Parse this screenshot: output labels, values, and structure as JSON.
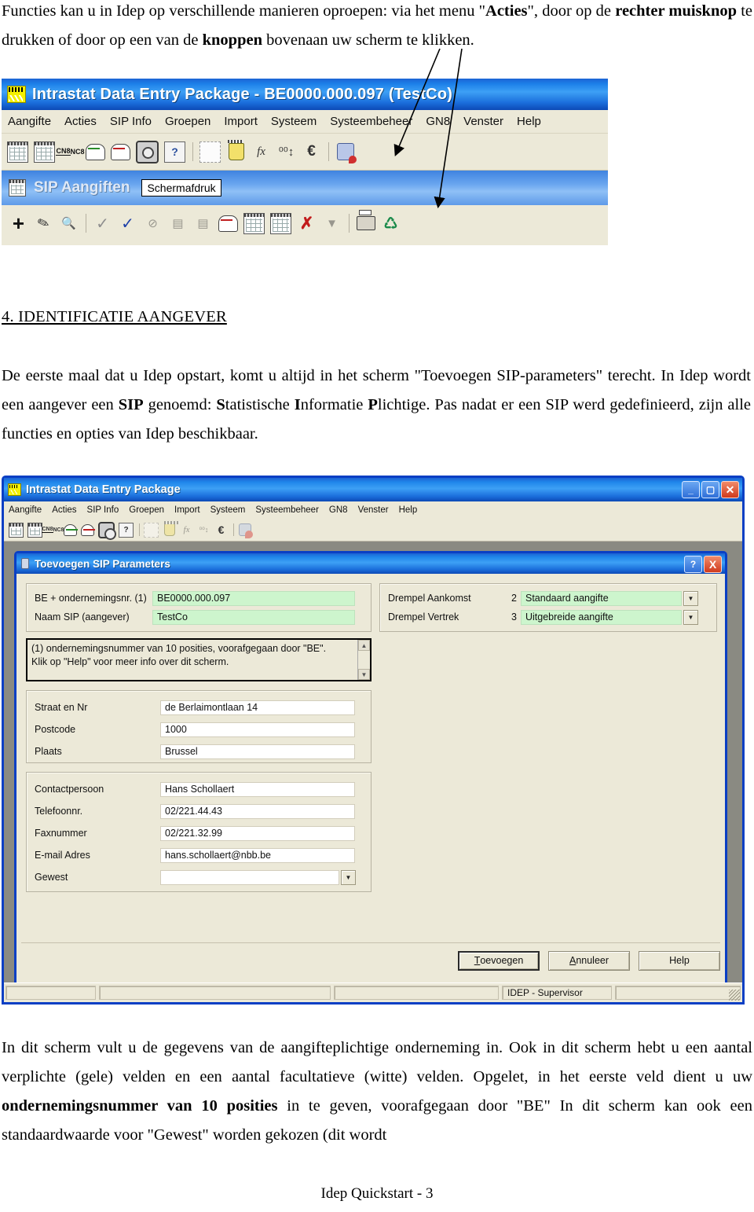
{
  "document": {
    "intro_html": "Functies kan u in Idep op verschillende manieren oproepen: via het  menu \"<b>Acties</b>\", door op de <b>rechter muisknop</b> te drukken of door op een van de <b>knoppen</b> bovenaan uw scherm te klikken.",
    "heading": "4. IDENTIFICATIE AANGEVER",
    "body1_html": "De eerste maal dat u Idep opstart, komt u altijd in het scherm \"Toevoegen SIP-parameters\" terecht. In Idep wordt een aangever een <b>SIP</b> genoemd: <b>S</b>tatistische <b>I</b>nformatie <b>P</b>lichtige. Pas nadat er een SIP werd gedefinieerd, zijn alle functies en opties van Idep beschikbaar.",
    "body2_html": "In dit scherm vult u de gegevens van de aangifteplichtige onderneming in. Ook in dit scherm hebt u een aantal verplichte (gele) velden en een aantal facultatieve (witte) velden. Opgelet, in het eerste veld dient u uw <b>ondernemingsnummer van 10 posities</b> in te geven, voorafgegaan door \"BE\" In dit scherm kan ook een standaardwaarde voor \"Gewest\" worden gekozen (dit wordt",
    "footer": "Idep Quickstart - 3"
  },
  "screenshot1": {
    "title": "Intrastat Data Entry Package - BE0000.000.097 (TestCo)",
    "menu": [
      "Aangifte",
      "Acties",
      "SIP Info",
      "Groepen",
      "Import",
      "Systeem",
      "Systeembeheer",
      "GN8",
      "Venster",
      "Help"
    ],
    "toolbar_icons": [
      "grid-icon",
      "binoculars-grid-icon",
      "cn8-nc8-icon",
      "envelope-green-icon",
      "envelope-red-icon",
      "camera-icon",
      "question-balloon-icon",
      "blank-page-icon",
      "bin-icon",
      "fx-icon",
      "decimal-icon",
      "euro-icon",
      "screenprint-icon"
    ],
    "subwindow_title": "SIP Aangiften",
    "tooltip": "Schermafdruk",
    "subtoolbar_icons": [
      "plus-icon",
      "pencil-icon",
      "magnifier-doc-icon",
      "check-icon",
      "check-plus-icon",
      "cancel-icon",
      "unlock-icon",
      "lock-doc-icon",
      "envelope-red-icon",
      "grid-search-icon",
      "grid-edit-icon",
      "delete-x-icon",
      "download-icon",
      "printer-icon",
      "recycle-icon"
    ]
  },
  "screenshot2": {
    "window_title": "Intrastat Data Entry Package",
    "window_buttons": [
      "minimize-button",
      "maximize-button",
      "close-button"
    ],
    "menu": [
      "Aangifte",
      "Acties",
      "SIP Info",
      "Groepen",
      "Import",
      "Systeem",
      "Systeembeheer",
      "GN8",
      "Venster",
      "Help"
    ],
    "toolbar_icons": [
      "grid-icon",
      "binoculars-grid-icon",
      "cn8-nc8-icon",
      "envelope-green-icon",
      "envelope-red-icon",
      "camera-icon",
      "question-balloon-icon",
      "blank-page-icon",
      "bin-icon",
      "fx-icon",
      "decimal-icon",
      "euro-icon",
      "screenprint-icon"
    ],
    "dialog": {
      "title": "Toevoegen SIP Parameters",
      "help_button": "?",
      "close_button": "X",
      "identification": [
        {
          "label": "BE + ondernemingsnr. (1)",
          "value": "BE0000.000.097",
          "required": true
        },
        {
          "label": "Naam SIP (aangever)",
          "value": "TestCo",
          "required": true
        }
      ],
      "thresholds": [
        {
          "label": "Drempel Aankomst",
          "code": "2",
          "value": "Standaard aangifte",
          "required": true
        },
        {
          "label": "Drempel Vertrek",
          "code": "3",
          "value": "Uitgebreide aangifte",
          "required": true
        }
      ],
      "memo": "(1) ondernemingsnummer van 10 posities, voorafgegaan door \"BE\".\nKlik op \"Help\" voor meer info over dit scherm.",
      "address": [
        {
          "label": "Straat en Nr",
          "value": "de Berlaimontlaan 14"
        },
        {
          "label": "Postcode",
          "value": "1000"
        },
        {
          "label": "Plaats",
          "value": "Brussel"
        }
      ],
      "contact": [
        {
          "label": "Contactpersoon",
          "value": "Hans Schollaert",
          "dropdown": false
        },
        {
          "label": "Telefoonnr.",
          "value": "02/221.44.43",
          "dropdown": false
        },
        {
          "label": "Faxnummer",
          "value": "02/221.32.99",
          "dropdown": false
        },
        {
          "label": "E-mail Adres",
          "value": "hans.schollaert@nbb.be",
          "dropdown": false
        },
        {
          "label": "Gewest",
          "value": "",
          "dropdown": true
        }
      ],
      "buttons": [
        {
          "label": "Toevoegen",
          "accel": "T",
          "default": true
        },
        {
          "label": "Annuleer",
          "accel": "A",
          "default": false
        },
        {
          "label": "Help",
          "accel": "",
          "default": false
        }
      ]
    },
    "statusbar": {
      "user": "IDEP - Supervisor"
    }
  },
  "colors": {
    "titlebar_blue": "#1c7fe8",
    "dialog_face": "#ece9d8",
    "required_field": "#cdf5cd",
    "optional_field": "#ffffff",
    "window_border": "#0a3fc4"
  }
}
